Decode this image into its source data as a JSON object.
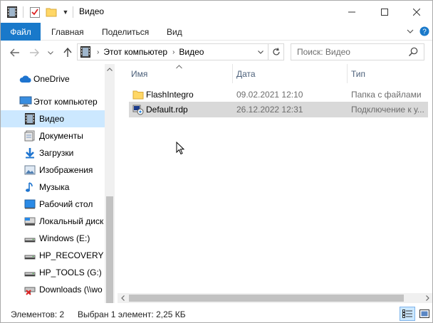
{
  "window": {
    "title": "Видео"
  },
  "ribbon": {
    "tabs": [
      {
        "label": "Файл",
        "active": true
      },
      {
        "label": "Главная"
      },
      {
        "label": "Поделиться"
      },
      {
        "label": "Вид"
      }
    ]
  },
  "address": {
    "crumbs": [
      "Этот компьютер",
      "Видео"
    ]
  },
  "search": {
    "placeholder": "Поиск: Видео"
  },
  "nav_pane": {
    "items": [
      {
        "label": "OneDrive",
        "icon": "onedrive-icon"
      },
      {
        "label": "Этот компьютер",
        "icon": "computer-icon"
      },
      {
        "label": "Видео",
        "icon": "video-icon",
        "selected": true
      },
      {
        "label": "Документы",
        "icon": "documents-icon"
      },
      {
        "label": "Загрузки",
        "icon": "downloads-icon"
      },
      {
        "label": "Изображения",
        "icon": "pictures-icon"
      },
      {
        "label": "Музыка",
        "icon": "music-icon"
      },
      {
        "label": "Рабочий стол",
        "icon": "desktop-icon"
      },
      {
        "label": "Локальный диск",
        "icon": "local-disk-icon"
      },
      {
        "label": "Windows  (E:)",
        "icon": "drive-icon"
      },
      {
        "label": "HP_RECOVERY (F",
        "icon": "drive-icon"
      },
      {
        "label": "HP_TOOLS (G:)",
        "icon": "drive-icon"
      },
      {
        "label": "Downloads (\\\\wo",
        "icon": "network-drive-disconnected-icon"
      }
    ]
  },
  "file_list": {
    "columns": [
      "Имя",
      "Дата",
      "Тип"
    ],
    "rows": [
      {
        "name": "FlashIntegro",
        "date": "09.02.2021 12:10",
        "type": "Папка с файлами",
        "icon": "folder-icon"
      },
      {
        "name": "Default.rdp",
        "date": "26.12.2022 12:31",
        "type": "Подключение к у...",
        "icon": "rdp-file-icon",
        "selected": true
      }
    ]
  },
  "status_bar": {
    "item_count": "Элементов: 2",
    "selection": "Выбран 1 элемент: 2,25 КБ"
  },
  "colors": {
    "accent": "#1979ca",
    "selection_nav": "#cce8ff",
    "selection_row": "#d9d9d9",
    "folder": "#ffd766"
  }
}
